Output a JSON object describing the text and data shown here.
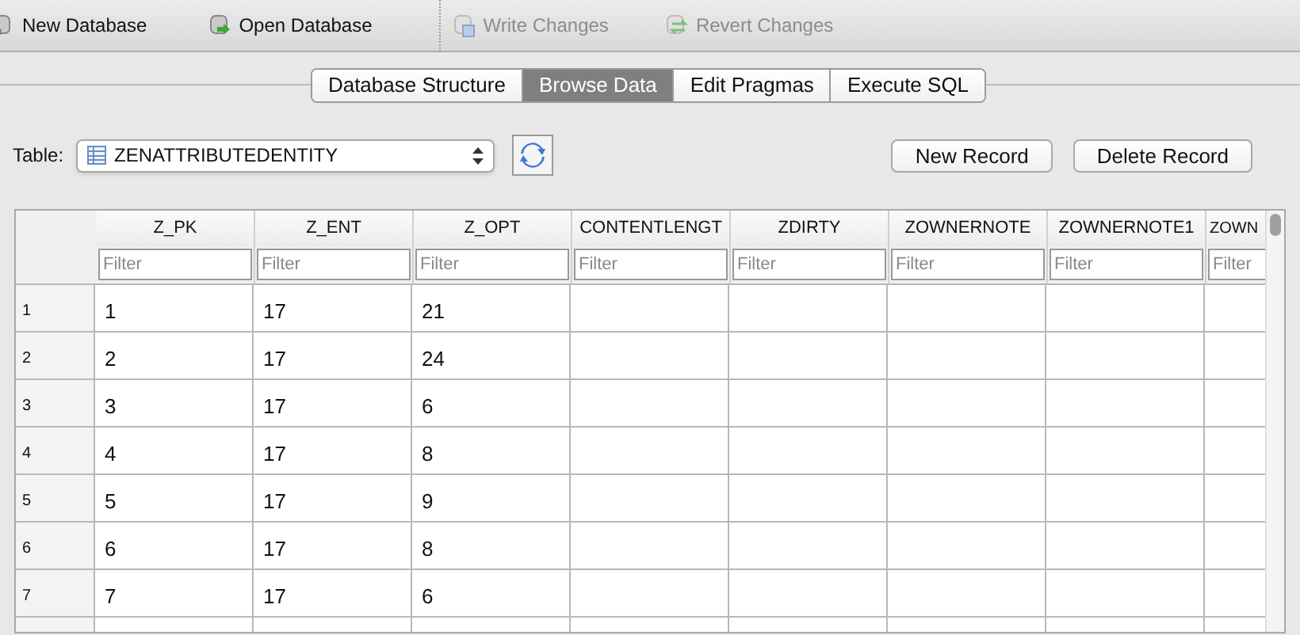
{
  "toolbar": [
    {
      "label": "New Database",
      "kind": "new",
      "disabled": false
    },
    {
      "label": "Open Database",
      "kind": "open",
      "disabled": false
    },
    {
      "label": "Write Changes",
      "kind": "write",
      "disabled": true
    },
    {
      "label": "Revert Changes",
      "kind": "revert",
      "disabled": true
    }
  ],
  "tabs": [
    {
      "label": "Database Structure",
      "selected": false
    },
    {
      "label": "Browse Data",
      "selected": true
    },
    {
      "label": "Edit Pragmas",
      "selected": false
    },
    {
      "label": "Execute SQL",
      "selected": false
    }
  ],
  "table_picker": {
    "label": "Table:",
    "value": "ZENATTRIBUTEDENTITY"
  },
  "buttons": [
    "New Record",
    "Delete Record"
  ],
  "grid": {
    "columns": [
      {
        "name": "Z_PK",
        "filter_placeholder": "Filter"
      },
      {
        "name": "Z_ENT",
        "filter_placeholder": "Filter"
      },
      {
        "name": "Z_OPT",
        "filter_placeholder": "Filter"
      },
      {
        "name": "CONTENTLENGT",
        "filter_placeholder": "Filter"
      },
      {
        "name": "ZDIRTY",
        "filter_placeholder": "Filter"
      },
      {
        "name": "ZOWNERNOTE",
        "filter_placeholder": "Filter"
      },
      {
        "name": "ZOWNERNOTE1",
        "filter_placeholder": "Filter"
      },
      {
        "name": "ZOWN",
        "filter_placeholder": "Filter"
      }
    ],
    "rows": [
      {
        "number": "1",
        "cells": [
          "1",
          "17",
          "21"
        ]
      },
      {
        "number": "2",
        "cells": [
          "2",
          "17",
          "24"
        ]
      },
      {
        "number": "3",
        "cells": [
          "3",
          "17",
          "6"
        ]
      },
      {
        "number": "4",
        "cells": [
          "4",
          "17",
          "8"
        ]
      },
      {
        "number": "5",
        "cells": [
          "5",
          "17",
          "9"
        ]
      },
      {
        "number": "6",
        "cells": [
          "6",
          "17",
          "8"
        ]
      },
      {
        "number": "7",
        "cells": [
          "7",
          "17",
          "6"
        ]
      }
    ]
  }
}
